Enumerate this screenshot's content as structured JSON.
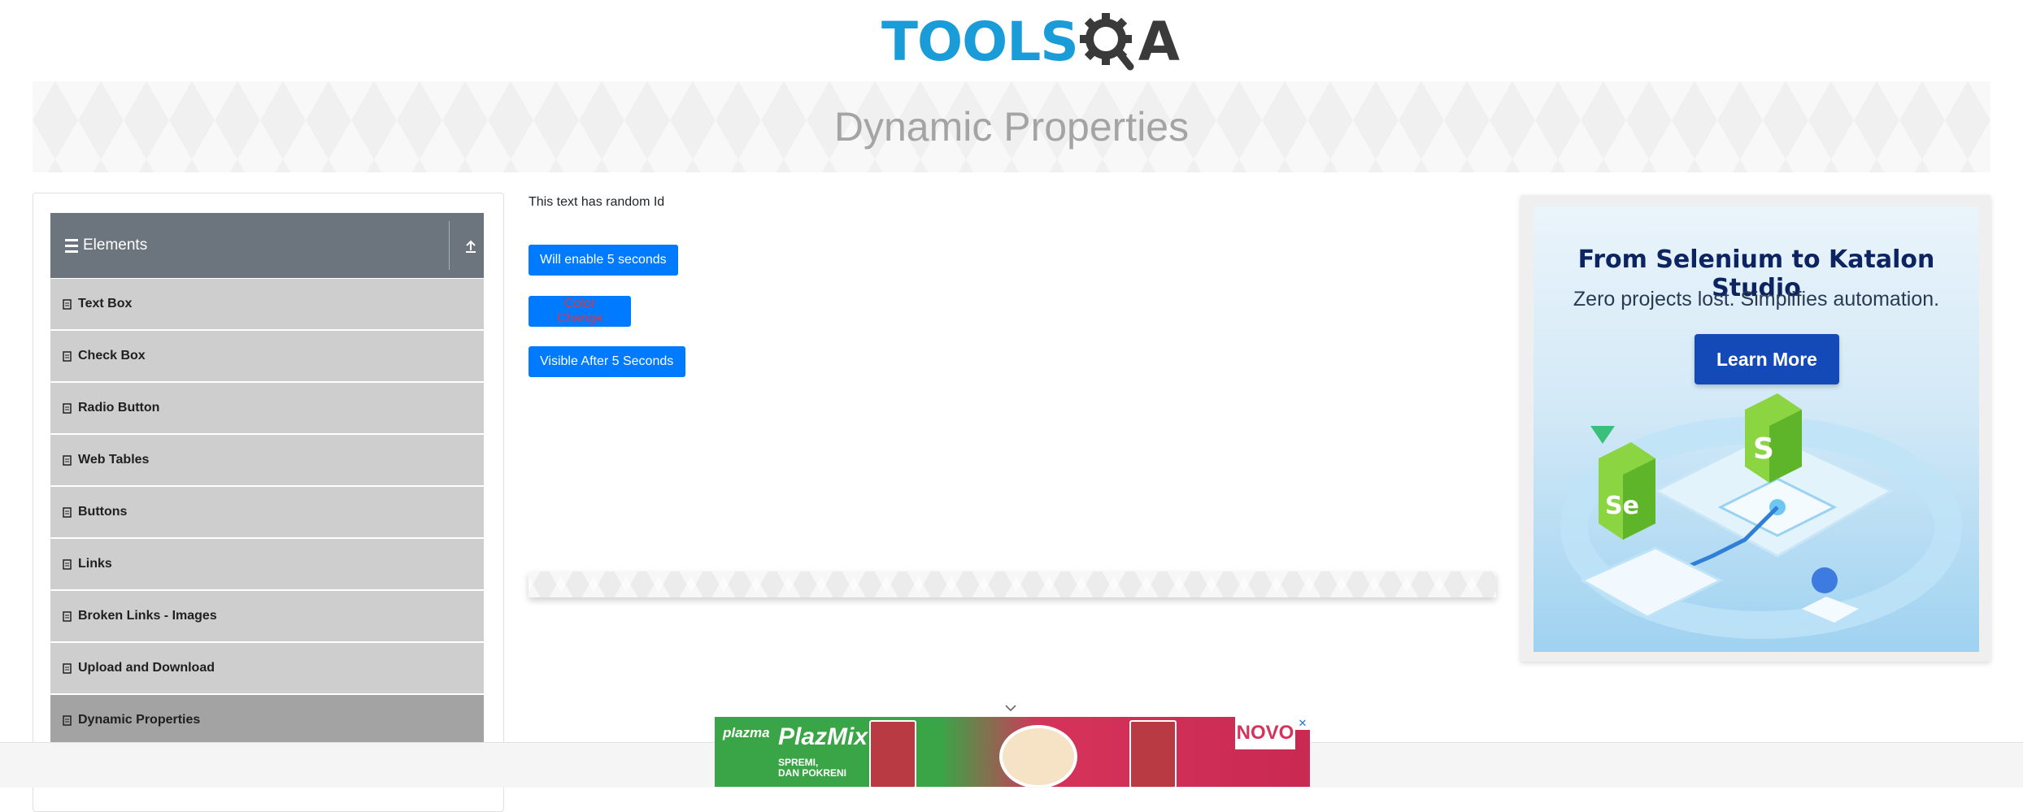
{
  "header": {
    "logo_tools": "TOOLS",
    "logo_qa": "A"
  },
  "banner": {
    "title": "Dynamic Properties"
  },
  "sidebar": {
    "group_title": "Elements",
    "items": [
      {
        "label": "Text Box"
      },
      {
        "label": "Check Box"
      },
      {
        "label": "Radio Button"
      },
      {
        "label": "Web Tables"
      },
      {
        "label": "Buttons"
      },
      {
        "label": "Links"
      },
      {
        "label": "Broken Links - Images"
      },
      {
        "label": "Upload and Download"
      },
      {
        "label": "Dynamic Properties"
      }
    ]
  },
  "main": {
    "random_text": "This text has random Id",
    "enable_button": "Will enable 5 seconds",
    "color_button": "Color Change",
    "visible_button": "Visible After 5 Seconds"
  },
  "ad": {
    "headline": "From Selenium to Katalon Studio",
    "subline": "Zero projects lost. Simplifies automation.",
    "cta": "Learn More"
  },
  "bottom_ad": {
    "brand": "plazma",
    "product": "PlazMix",
    "tagline_1": "SPREMI,",
    "tagline_2": "DAN POKRENI",
    "badge": "NOVO"
  },
  "colors": {
    "primary": "#007bff",
    "sidebar_header": "#6c757d",
    "menu_item": "#cecece",
    "menu_active": "#a3a3a3",
    "danger_text": "#dc3545"
  },
  "icons": [
    "gear-icon",
    "hamburger-icon",
    "arrow-up-icon",
    "document-icon",
    "chevron-down-icon",
    "close-icon"
  ]
}
